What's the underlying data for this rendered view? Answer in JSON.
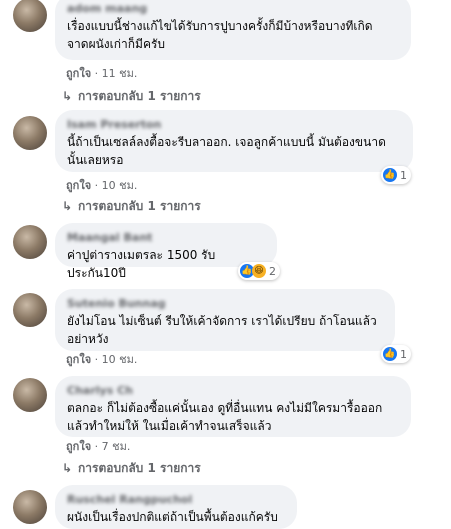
{
  "comments": [
    {
      "author": "adom maang",
      "text": "เรื่องแบบนี้ช่างแก้ไขได้รับการปูบางครั้งก็มีบ้างหรือบางทีเกิด\nจาดผนังเก่าก็มีครับ",
      "like_label": "ถูกใจ",
      "time": "11 ชม.",
      "replies": "การตอบกลับ 1 รายการ"
    },
    {
      "author": "Isam Preserton",
      "text": "นี้ถ้าเป็นเซลล์ลงตื้อจะรีบลาออก. เจอลูกค้าแบบนี้ มันต้องขนาด\nนั้นเลยหรอ",
      "like_label": "ถูกใจ",
      "time": "10 ชม.",
      "reaction_count": "1",
      "replies": "การตอบกลับ 1 รายการ"
    },
    {
      "author": "Maangal Bant",
      "text": "ค่าปูต่ารางเมตรละ 1500 รับประกัน10ปี",
      "reaction_count": "2"
    },
    {
      "author": "Sutenio Bunnag",
      "text": "ยังไม่โอน ไม่เซ็นต์ รีบให้เค้าจัดการ เราได้เปรียบ ถ้าโอนแล้ว\nอย่าหวัง",
      "like_label": "ถูกใจ",
      "time": "10 ชม.",
      "reaction_count": "1"
    },
    {
      "author": "Charlys Ch",
      "text": "ตลกอะ ก็ไม่ต้องซื้อแค่นั้นเอง ดูที่อื่นแทน คงไม่มีใครมารื้อออก\nแล้วทำใหม่ให้ ในเมื่อเค้าทำจนเสร็จแล้ว",
      "like_label": "ถูกใจ",
      "time": "7 ชม.",
      "replies": "การตอบกลับ 1 รายการ"
    },
    {
      "author": "Ruschel Rangpuchol",
      "text": "ผนังเป็นเรื่องปกติแต่ถ้าเป็นพื้นต้องแก้ครับ"
    }
  ],
  "icons": {
    "like": "thumbs-up-icon",
    "haha": "haha-icon",
    "reply": "reply-arrow-icon"
  },
  "colors": {
    "bubble": "#f0f2f5",
    "meta": "#65676b",
    "like": "#1877f2"
  }
}
